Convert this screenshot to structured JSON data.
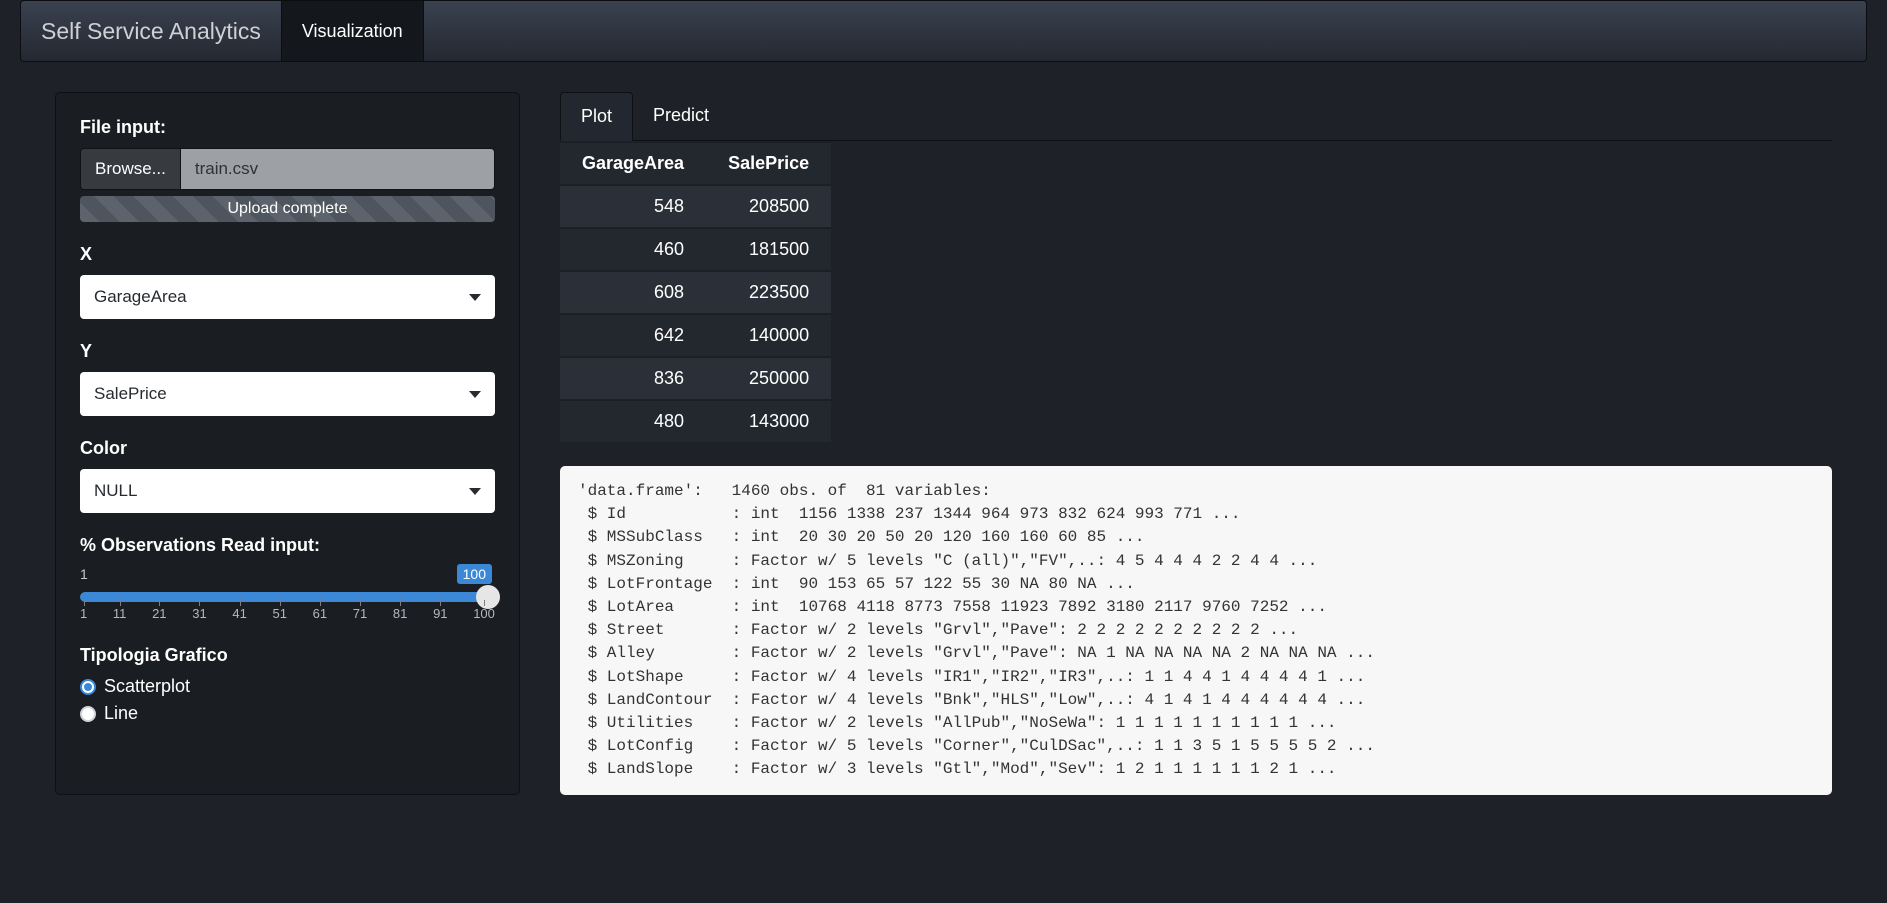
{
  "navbar": {
    "brand": "Self Service Analytics",
    "tab": "Visualization"
  },
  "sidebar": {
    "file_label": "File input:",
    "browse_label": "Browse...",
    "file_name": "train.csv",
    "upload_status": "Upload complete",
    "x_label": "X",
    "x_value": "GarageArea",
    "y_label": "Y",
    "y_value": "SalePrice",
    "color_label": "Color",
    "color_value": "NULL",
    "obs_label": "% Observations Read input:",
    "slider_min": "1",
    "slider_max_badge": "100",
    "ticks": [
      "1",
      "11",
      "21",
      "31",
      "41",
      "51",
      "61",
      "71",
      "81",
      "91",
      "100"
    ],
    "tipologia_label": "Tipologia Grafico",
    "radio_scatter": "Scatterplot",
    "radio_line": "Line"
  },
  "tabs": {
    "plot": "Plot",
    "predict": "Predict"
  },
  "table": {
    "headers": [
      "GarageArea",
      "SalePrice"
    ],
    "rows": [
      [
        "548",
        "208500"
      ],
      [
        "460",
        "181500"
      ],
      [
        "608",
        "223500"
      ],
      [
        "642",
        "140000"
      ],
      [
        "836",
        "250000"
      ],
      [
        "480",
        "143000"
      ]
    ]
  },
  "str_output": "'data.frame':   1460 obs. of  81 variables:\n $ Id           : int  1156 1338 237 1344 964 973 832 624 993 771 ...\n $ MSSubClass   : int  20 30 20 50 20 120 160 160 60 85 ...\n $ MSZoning     : Factor w/ 5 levels \"C (all)\",\"FV\",..: 4 5 4 4 4 2 2 4 4 ...\n $ LotFrontage  : int  90 153 65 57 122 55 30 NA 80 NA ...\n $ LotArea      : int  10768 4118 8773 7558 11923 7892 3180 2117 9760 7252 ...\n $ Street       : Factor w/ 2 levels \"Grvl\",\"Pave\": 2 2 2 2 2 2 2 2 2 2 ...\n $ Alley        : Factor w/ 2 levels \"Grvl\",\"Pave\": NA 1 NA NA NA NA 2 NA NA NA ...\n $ LotShape     : Factor w/ 4 levels \"IR1\",\"IR2\",\"IR3\",..: 1 1 4 4 1 4 4 4 4 1 ...\n $ LandContour  : Factor w/ 4 levels \"Bnk\",\"HLS\",\"Low\",..: 4 1 4 1 4 4 4 4 4 4 ...\n $ Utilities    : Factor w/ 2 levels \"AllPub\",\"NoSeWa\": 1 1 1 1 1 1 1 1 1 1 ...\n $ LotConfig    : Factor w/ 5 levels \"Corner\",\"CulDSac\",..: 1 1 3 5 1 5 5 5 5 2 ...\n $ LandSlope    : Factor w/ 3 levels \"Gtl\",\"Mod\",\"Sev\": 1 2 1 1 1 1 1 1 2 1 ..."
}
